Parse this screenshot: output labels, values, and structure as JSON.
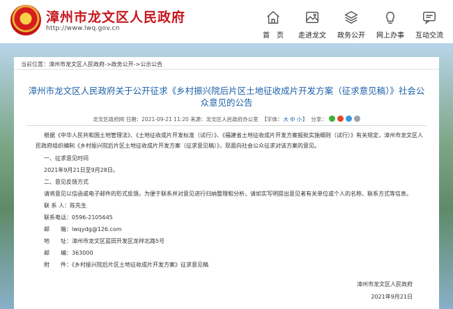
{
  "header": {
    "site_title": "漳州市龙文区人民政府",
    "site_url": "http://www.lwq.gov.cn",
    "nav": [
      {
        "label": "首　页",
        "icon": "home-icon"
      },
      {
        "label": "走进龙文",
        "icon": "image-icon"
      },
      {
        "label": "政务公开",
        "icon": "layers-icon"
      },
      {
        "label": "网上办事",
        "icon": "bulb-icon"
      },
      {
        "label": "互动交流",
        "icon": "chat-icon"
      }
    ]
  },
  "breadcrumb": {
    "prefix": "当前位置：",
    "items": [
      "漳州市龙文区人民政府",
      "政务公开",
      "公示公告"
    ],
    "separator": "->"
  },
  "article": {
    "title": "漳州市龙文区人民政府关于公开征求《乡村振兴院后片区土地征收成片开发方案（征求意见稿）》社会公众意见的公告",
    "meta": {
      "publisher": "龙文区政府网",
      "date_label": "日期：",
      "date": "2021-09-21 11:20",
      "source_label": "来源：",
      "source": "龙文区人民政府办公室",
      "font_label": "【字体：",
      "font_sizes": [
        "大",
        "中",
        "小"
      ],
      "font_close": "】",
      "share_label": "分享："
    },
    "paragraphs": [
      "根据《中华人民共和国土地管理法》、《土地征收成片开发标准（试行）》、《福建省土地征收成片开发方案报批实施细则（试行）》有关规定，漳州市龙文区人民政府组织编制《乡村振兴院后片区土地征收成片开发方案（征求意见稿）》，现面向社会公众征求对该方案的意见。",
      "一、征求意见时间",
      "2021年9月21日至9月28日。",
      "二、意见反馈方式",
      "请将意见以信函或电子邮件的形式反馈。为便于联系并对意见进行归纳整理和分析，请如实写明提出意见者有关单位或个人的名称、联系方式等信息。",
      "联 系 人：陈先生",
      "联系电话：0596-2105645",
      "邮　　箱：lwqydg@126.com",
      "地　　址：漳州市龙文区蓝田开发区龙祥北路5号",
      "邮　　编：363000",
      "附　　件：《乡村振兴院后片区土地征收成片开发方案》征求意见稿"
    ],
    "signature": {
      "org": "漳州市龙文区人民政府",
      "date": "2021年9月21日"
    }
  },
  "colors": {
    "brand_red": "#c4161c",
    "title_blue": "#1a5fa8"
  }
}
